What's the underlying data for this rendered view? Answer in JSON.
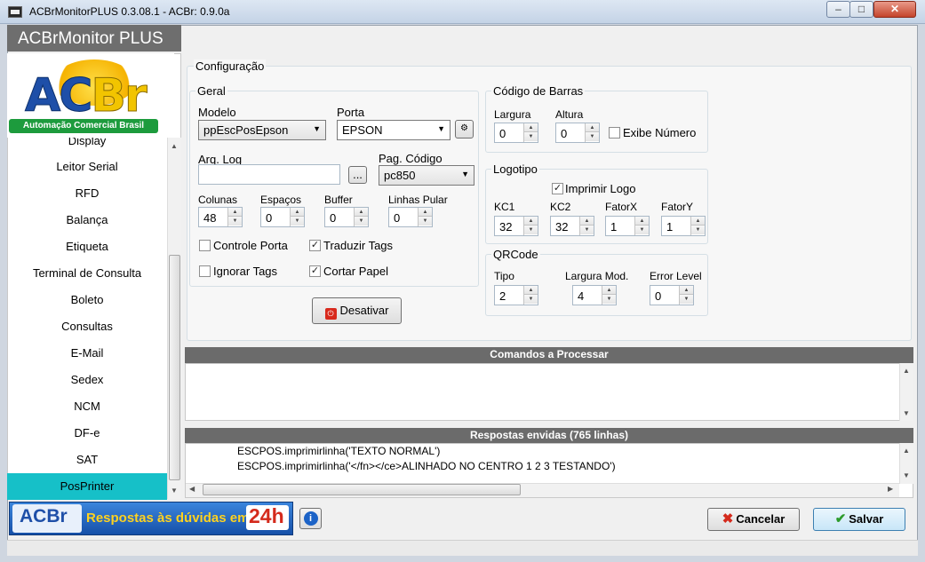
{
  "window": {
    "title": "ACBrMonitorPLUS 0.3.08.1 - ACBr: 0.9.0a",
    "min": "–",
    "max": "□",
    "close": "✕"
  },
  "banner": {
    "title": "ACBrMonitor PLUS"
  },
  "logo": {
    "a": "AC",
    "br": "Br",
    "strip": "Automação Comercial Brasil"
  },
  "sidebar": {
    "items": [
      {
        "label": "Display"
      },
      {
        "label": "Leitor Serial"
      },
      {
        "label": "RFD"
      },
      {
        "label": "Balança"
      },
      {
        "label": "Etiqueta"
      },
      {
        "label": "Terminal de Consulta"
      },
      {
        "label": "Boleto"
      },
      {
        "label": "Consultas"
      },
      {
        "label": "E-Mail"
      },
      {
        "label": "Sedex"
      },
      {
        "label": "NCM"
      },
      {
        "label": "DF-e"
      },
      {
        "label": "SAT"
      },
      {
        "label": "PosPrinter"
      }
    ],
    "active": "PosPrinter"
  },
  "config": {
    "title": "Configuração",
    "geral": {
      "title": "Geral",
      "modelo_label": "Modelo",
      "modelo_value": "ppEscPosEpson",
      "porta_label": "Porta",
      "porta_value": "EPSON",
      "arqlog_label": "Arq. Log",
      "arqlog_value": "",
      "browse_label": "...",
      "pagcodigo_label": "Pag. Código",
      "pagcodigo_value": "pc850",
      "colunas_label": "Colunas",
      "colunas_value": "48",
      "espacos_label": "Espaços",
      "espacos_value": "0",
      "buffer_label": "Buffer",
      "buffer_value": "0",
      "linhaspular_label": "Linhas Pular",
      "linhaspular_value": "0",
      "controle_porta": "Controle Porta",
      "traduzir_tags": "Traduzir Tags",
      "ignorar_tags": "Ignorar Tags",
      "cortar_papel": "Cortar Papel"
    },
    "desativar_label": "Desativar",
    "codigo_barras": {
      "title": "Código de Barras",
      "largura_label": "Largura",
      "largura_value": "0",
      "altura_label": "Altura",
      "altura_value": "0",
      "exibe_numero": "Exibe Número"
    },
    "logotipo": {
      "title": "Logotipo",
      "imprimir_logo": "Imprimir Logo",
      "kc1_label": "KC1",
      "kc1_value": "32",
      "kc2_label": "KC2",
      "kc2_value": "32",
      "fatorx_label": "FatorX",
      "fatorx_value": "1",
      "fatory_label": "FatorY",
      "fatory_value": "1"
    },
    "qrcode": {
      "title": "QRCode",
      "tipo_label": "Tipo",
      "tipo_value": "2",
      "largura_mod_label": "Largura Mod.",
      "largura_mod_value": "4",
      "error_level_label": "Error Level",
      "error_level_value": "0"
    }
  },
  "comandos": {
    "title": "Comandos a Processar"
  },
  "respostas": {
    "title": "Respostas envidas (765 linhas)",
    "lines": [
      "ESCPOS.imprimirlinha('TEXTO NORMAL')",
      "ESCPOS.imprimirlinha('</fn></ce>ALINHADO NO CENTRO 1 2 3 TESTANDO')"
    ]
  },
  "footer": {
    "promo": "Respostas às dúvidas em",
    "promo_24h": "24h",
    "promo_logo": "ACBr",
    "cancelar_label": "Cancelar",
    "salvar_label": "Salvar"
  },
  "colors": {
    "active_item": "#16c0c8",
    "panel_header": "#6b6b6b",
    "promo_bg": "#1f68c9"
  }
}
